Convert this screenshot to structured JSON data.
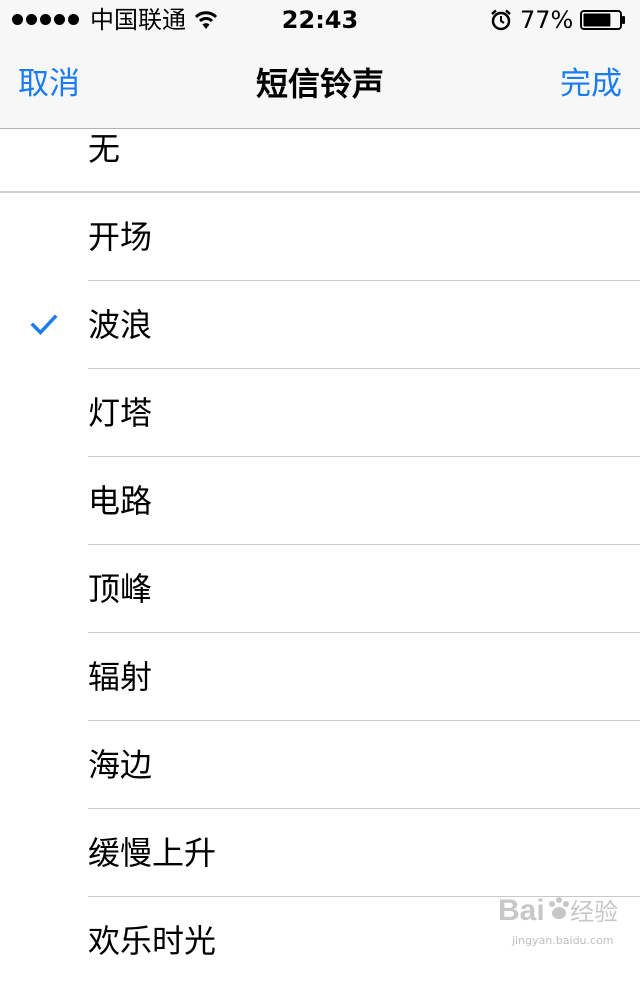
{
  "status_bar": {
    "carrier": "中国联通",
    "time": "22:43",
    "battery": "77%",
    "battery_level": 0.77,
    "signal_bars": 5
  },
  "nav": {
    "cancel_label": "取消",
    "title": "短信铃声",
    "done_label": "完成"
  },
  "none_option": {
    "label": "无"
  },
  "tones": [
    {
      "label": "开场",
      "selected": false
    },
    {
      "label": "波浪",
      "selected": true
    },
    {
      "label": "灯塔",
      "selected": false
    },
    {
      "label": "电路",
      "selected": false
    },
    {
      "label": "顶峰",
      "selected": false
    },
    {
      "label": "辐射",
      "selected": false
    },
    {
      "label": "海边",
      "selected": false
    },
    {
      "label": "缓慢上升",
      "selected": false
    },
    {
      "label": "欢乐时光",
      "selected": false
    }
  ],
  "watermark": {
    "text": "Baidu经验",
    "url_text": "jingyan.baidu.com"
  },
  "colors": {
    "accent": "#1a7cf3",
    "bar_background": "#f7f7f7",
    "separator": "#c8c7cc"
  },
  "icons": {
    "wifi": "wifi-icon",
    "alarm": "alarm-icon",
    "battery": "battery-icon",
    "check": "checkmark-icon"
  }
}
